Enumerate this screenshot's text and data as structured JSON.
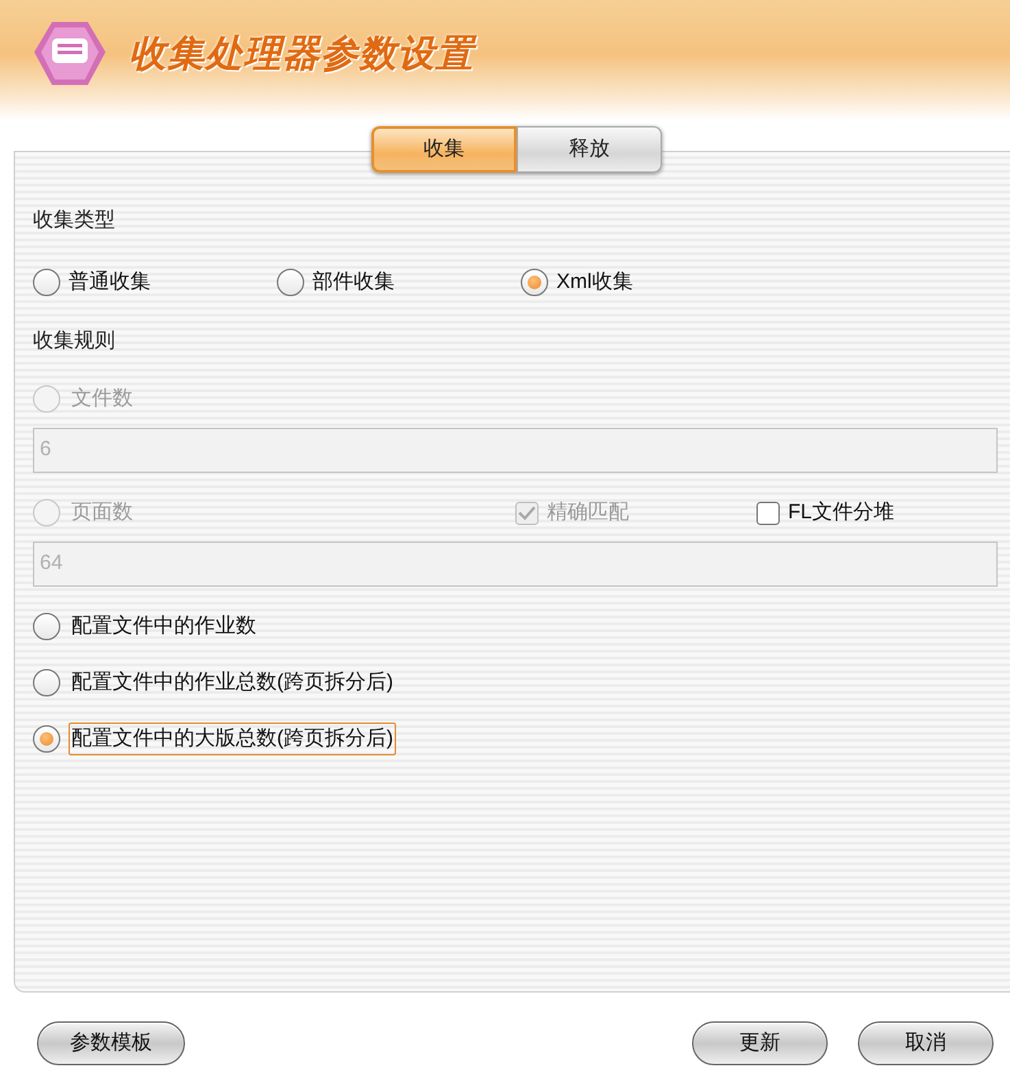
{
  "window": {
    "title": "收集处理器参数设置"
  },
  "tabs": [
    {
      "label": "收集",
      "selected": true
    },
    {
      "label": "释放",
      "selected": false
    }
  ],
  "collect_type": {
    "label": "收集类型",
    "options": [
      {
        "label": "普通收集",
        "selected": false
      },
      {
        "label": "部件收集",
        "selected": false
      },
      {
        "label": "Xml收集",
        "selected": true
      }
    ]
  },
  "collect_rule": {
    "label": "收集规则",
    "items": [
      {
        "kind": "radio",
        "label": "文件数",
        "selected": false,
        "disabled": true,
        "focused": false
      },
      {
        "kind": "field",
        "value": "6",
        "disabled": true
      },
      {
        "kind": "radio",
        "label": "页面数",
        "selected": false,
        "disabled": true,
        "focused": false,
        "checkboxes": [
          {
            "label": "精确匹配",
            "checked": true,
            "disabled": true
          },
          {
            "label": "FL文件分堆",
            "checked": false,
            "disabled": false
          }
        ]
      },
      {
        "kind": "field",
        "value": "64",
        "disabled": true
      },
      {
        "kind": "radio",
        "label": "配置文件中的作业数",
        "selected": false,
        "disabled": false,
        "focused": false
      },
      {
        "kind": "radio",
        "label": "配置文件中的作业总数(跨页拆分后)",
        "selected": false,
        "disabled": false,
        "focused": false
      },
      {
        "kind": "radio",
        "label": "配置文件中的大版总数(跨页拆分后)",
        "selected": true,
        "disabled": false,
        "focused": true
      }
    ]
  },
  "buttons_left": [
    "参数模板"
  ],
  "buttons_right": [
    "更新",
    "取消"
  ]
}
